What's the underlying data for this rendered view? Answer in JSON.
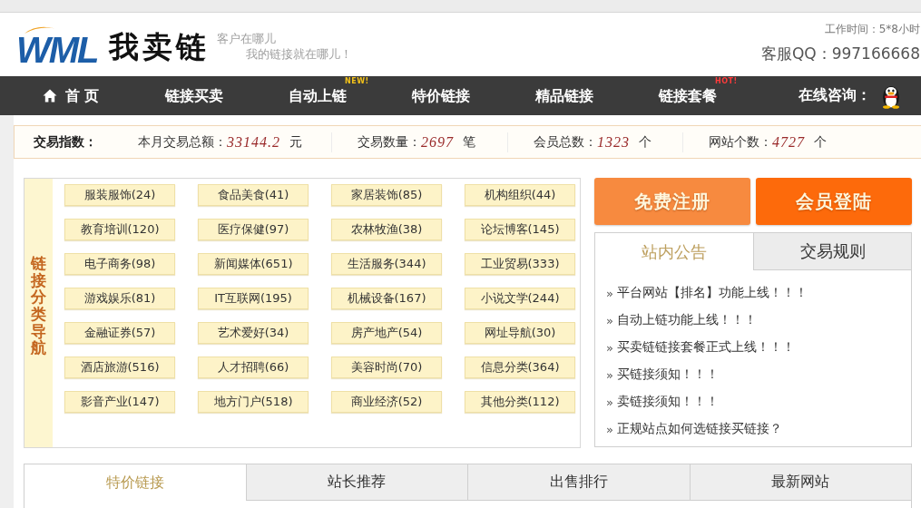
{
  "header": {
    "logo": {
      "mark": "WML",
      "name": "我卖链"
    },
    "slogans": [
      "客户在哪儿",
      "我的链接就在哪儿！"
    ],
    "work_hours": "工作时间：5*8小时",
    "service_qq": "客服QQ：997166668"
  },
  "nav": {
    "items": [
      {
        "label": "首 页",
        "kind": "home"
      },
      {
        "label": "链接买卖",
        "kind": "link"
      },
      {
        "label": "自动上链",
        "kind": "link",
        "tag": {
          "text": "NEW!",
          "kind": "new"
        }
      },
      {
        "label": "特价链接",
        "kind": "link"
      },
      {
        "label": "精品链接",
        "kind": "link"
      },
      {
        "label": "链接套餐",
        "kind": "link",
        "tag": {
          "text": "HOT!",
          "kind": "hot"
        }
      }
    ],
    "contact": {
      "label": "在线咨询："
    }
  },
  "stats": {
    "title": "交易指数：",
    "items": [
      {
        "label": "本月交易总额：",
        "value": "33144.2",
        "unit": "元"
      },
      {
        "label": "交易数量：",
        "value": "2697",
        "unit": "笔"
      },
      {
        "label": "会员总数：",
        "value": "1323",
        "unit": "个"
      },
      {
        "label": "网站个数：",
        "value": "4727",
        "unit": "个"
      }
    ]
  },
  "categories": {
    "title": "链接分类导航",
    "items": [
      "服装服饰(24)",
      "食品美食(41)",
      "家居装饰(85)",
      "机构组织(44)",
      "教育培训(120)",
      "医疗保健(97)",
      "农林牧渔(38)",
      "论坛博客(145)",
      "电子商务(98)",
      "新闻媒体(651)",
      "生活服务(344)",
      "工业贸易(333)",
      "游戏娱乐(81)",
      "IT互联网(195)",
      "机械设备(167)",
      "小说文学(244)",
      "金融证券(57)",
      "艺术爱好(34)",
      "房产地产(54)",
      "网址导航(30)",
      "酒店旅游(516)",
      "人才招聘(66)",
      "美容时尚(70)",
      "信息分类(364)",
      "影音产业(147)",
      "地方门户(518)",
      "商业经济(52)",
      "其他分类(112)"
    ]
  },
  "actions": [
    {
      "label": "免费注册",
      "kind": "register"
    },
    {
      "label": "会员登陆",
      "kind": "login"
    }
  ],
  "notices": {
    "tabs": [
      {
        "label": "站内公告",
        "selected": true
      },
      {
        "label": "交易规则",
        "selected": false
      }
    ],
    "items": [
      {
        "marker": "»",
        "text": "平台网站【排名】功能上线！！！"
      },
      {
        "marker": "»",
        "text": "自动上链功能上线！！！"
      },
      {
        "marker": "»",
        "text": "买卖链链接套餐正式上线！！！"
      },
      {
        "marker": "»",
        "text": "买链接须知！！！"
      },
      {
        "marker": "»",
        "text": "卖链接须知！！！"
      },
      {
        "marker": "»",
        "text": "正规站点如何选链接买链接？"
      }
    ]
  },
  "bottom_tabs": [
    {
      "label": "特价链接",
      "selected": true
    },
    {
      "label": "站长推荐",
      "selected": false
    },
    {
      "label": "出售排行",
      "selected": false
    },
    {
      "label": "最新网站",
      "selected": false
    }
  ]
}
